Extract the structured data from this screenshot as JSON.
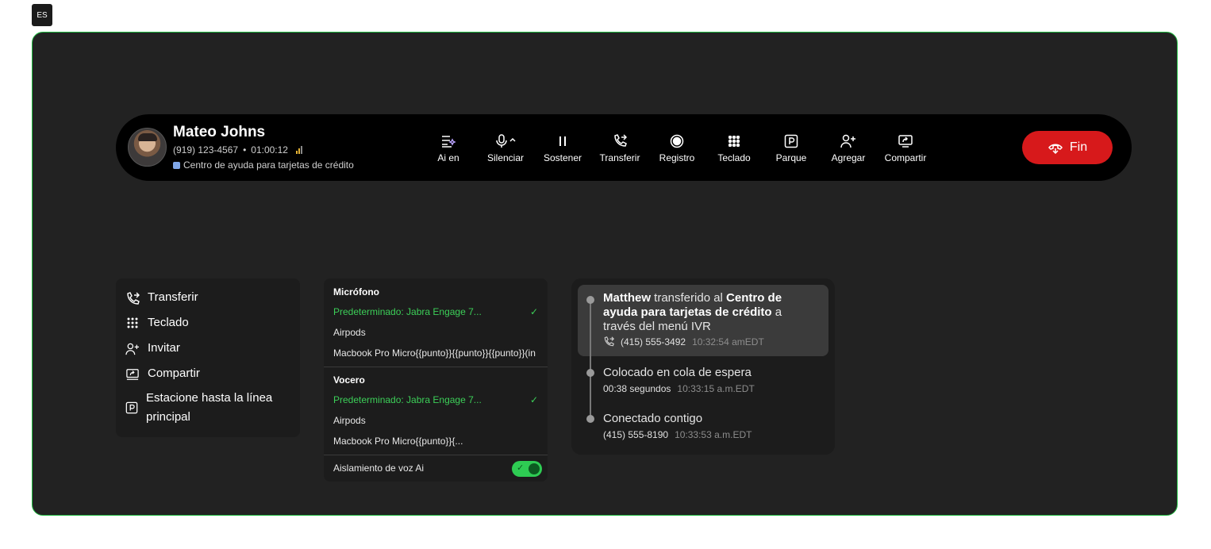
{
  "lang_badge": "ES",
  "caller": {
    "name": "Mateo Johns",
    "phone": "(919) 123-4567",
    "separator": "•",
    "duration": "01:00:12",
    "queue": "Centro de ayuda para tarjetas de crédito"
  },
  "controls": [
    {
      "label": "Ai en",
      "icon": "ai-sparkle-icon"
    },
    {
      "label": "Silenciar",
      "icon": "microphone-icon"
    },
    {
      "label": "Sostener",
      "icon": "pause-icon"
    },
    {
      "label": "Transferir",
      "icon": "transfer-icon"
    },
    {
      "label": "Registro",
      "icon": "record-icon"
    },
    {
      "label": "Teclado",
      "icon": "keypad-icon"
    },
    {
      "label": "Parque",
      "icon": "park-icon"
    },
    {
      "label": "Agregar",
      "icon": "add-user-icon"
    },
    {
      "label": "Compartir",
      "icon": "share-screen-icon"
    }
  ],
  "end_button": {
    "label": "Fin",
    "color": "#d7191b"
  },
  "menu": {
    "items": [
      {
        "label": "Transferir",
        "icon": "transfer-icon"
      },
      {
        "label": "Teclado",
        "icon": "keypad-icon"
      },
      {
        "label": "Invitar",
        "icon": "add-user-icon"
      },
      {
        "label": "Compartir",
        "icon": "share-screen-icon"
      },
      {
        "label": "Estacione hasta la línea principal",
        "icon": "park-icon"
      }
    ]
  },
  "audio": {
    "mic_title": "Micrófono",
    "mic_options": [
      "Predeterminado: Jabra Engage 7...",
      "Airpods",
      "Macbook Pro Micro{{punto}}{{punto}}{{punto}}(in"
    ],
    "speaker_title": "Vocero",
    "speaker_options": [
      "Predeterminado: Jabra Engage 7...",
      "Airpods",
      "Macbook Pro Micro{{punto}}{..."
    ],
    "voice_isolation_label": "Aislamiento de voz Ai",
    "voice_isolation_on": true,
    "accent": "#3ccf58"
  },
  "timeline": {
    "e1": {
      "name": "Matthew",
      "text_mid": " transferido al ",
      "dest": "Centro de ayuda para tarjetas de crédito",
      "text_end": " a través del menú IVR",
      "phone": "(415) 555-3492",
      "time": "10:32:54 amEDT"
    },
    "e2": {
      "title": "Colocado en cola de espera",
      "detail": "00:38 segundos",
      "time": "10:33:15 a.m.EDT"
    },
    "e3": {
      "title": "Conectado contigo",
      "detail": "(415) 555-8190",
      "time": "10:33:53 a.m.EDT"
    }
  }
}
